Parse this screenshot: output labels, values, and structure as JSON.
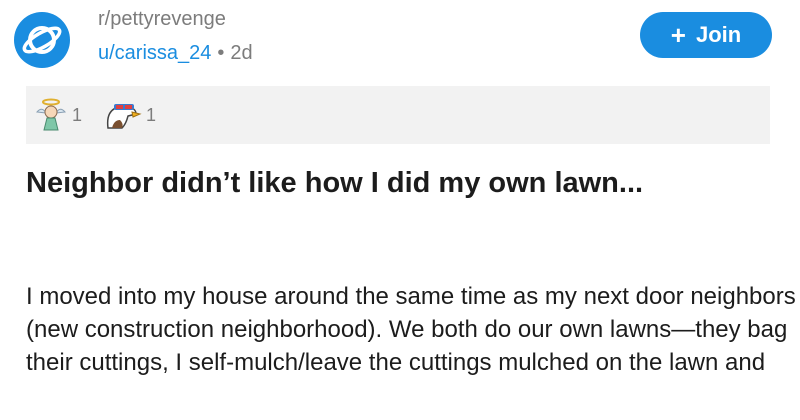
{
  "post": {
    "subreddit": "r/pettyrevenge",
    "author": "u/carissa_24",
    "separator": "•",
    "age": "2d",
    "join_label": "Join",
    "join_icon": "plus-icon",
    "accent_color": "#1a8de0",
    "awards": [
      {
        "icon": "angel-award-icon",
        "count": "1"
      },
      {
        "icon": "eagle-award-icon",
        "count": "1"
      }
    ],
    "title": "Neighbor didn’t like how I did my own lawn...",
    "body": "I moved into my house around the same time as my next door neighbors (new construction neighborhood). We both do our own lawns—they bag their cuttings, I self-mulch/leave the cuttings mulched on the lawn and"
  }
}
